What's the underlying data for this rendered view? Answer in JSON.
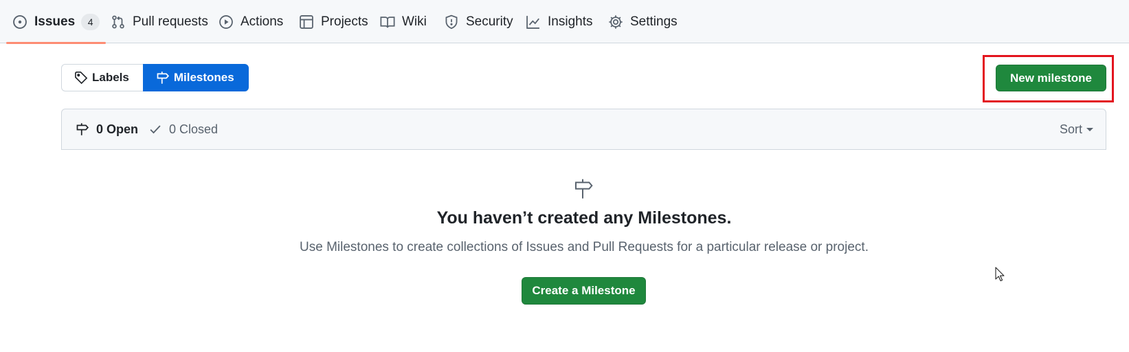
{
  "repo_nav": {
    "items": [
      {
        "label": "Issues",
        "icon": "issue-opened-icon",
        "count": "4",
        "selected": true
      },
      {
        "label": "Pull requests",
        "icon": "git-pull-request-icon"
      },
      {
        "label": "Actions",
        "icon": "play-icon"
      },
      {
        "label": "Projects",
        "icon": "table-icon"
      },
      {
        "label": "Wiki",
        "icon": "book-icon"
      },
      {
        "label": "Security",
        "icon": "shield-icon"
      },
      {
        "label": "Insights",
        "icon": "graph-icon"
      },
      {
        "label": "Settings",
        "icon": "gear-icon"
      }
    ]
  },
  "subnav": {
    "labels": {
      "label": "Labels",
      "icon": "tag-icon"
    },
    "milestones": {
      "label": "Milestones",
      "icon": "milestone-icon",
      "selected": true
    }
  },
  "toolbar": {
    "new_milestone_label": "New milestone",
    "highlighted": true,
    "highlight_color": "#e3141e"
  },
  "milestones_header": {
    "open_label": "0 Open",
    "closed_label": "0 Closed",
    "sort_label": "Sort"
  },
  "blankslate": {
    "icon": "milestone-icon",
    "title": "You haven’t created any Milestones.",
    "description": "Use Milestones to create collections of Issues and Pull Requests for a particular release or project.",
    "button_label": "Create a Milestone"
  },
  "colors": {
    "accent_blue": "#0969da",
    "primary_green": "#1f883d",
    "nav_underline": "#fd8c73"
  }
}
